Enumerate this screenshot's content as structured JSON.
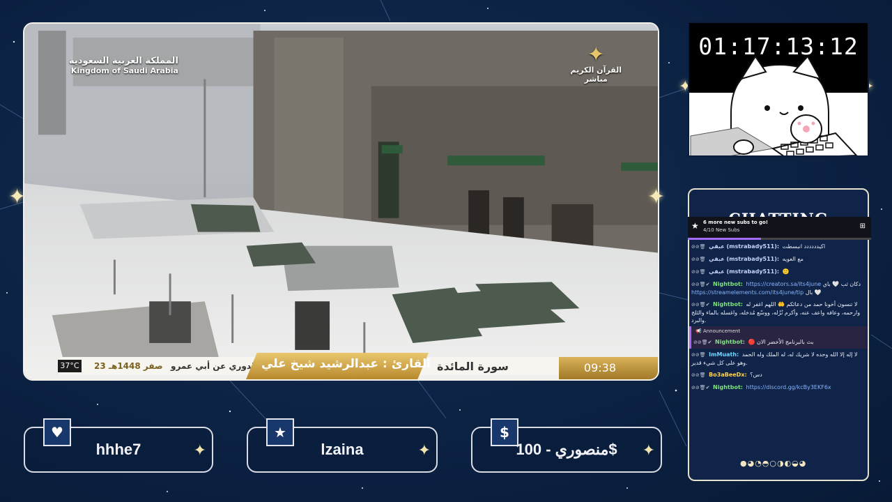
{
  "video": {
    "overlay_ksa_ar": "المملكة العربية السعودية",
    "overlay_ksa_en": "Kingdom of Saudi Arabia",
    "channel_name": "القرآن الكريم",
    "channel_status": "مباشر",
    "temperature": "37°C",
    "date_hijri": "23 صفر 1448هـ",
    "narration": "رواية الدوري عن أبي عمرو",
    "reader": "القارئ : عبدالرشيد شيخ علي",
    "surah": "سورة المائدة",
    "clock": "09:38"
  },
  "timer": "01:17:13:12",
  "chat": {
    "heading": "CHATTING",
    "sub_goal_title": "6 more new subs to go!",
    "sub_goal_count": "4/10 New Subs",
    "sub_goal_progress": 0.4,
    "announcement_label": "Announcement",
    "messages": [
      {
        "badges": "⊘⊘🗑",
        "user": "عبقي (mstrabady511):",
        "user_color": "#c8d4ff",
        "text": "اكيدددددد انبسطت"
      },
      {
        "badges": "⊘⊘🗑",
        "user": "عبقي (mstrabady511):",
        "user_color": "#c8d4ff",
        "text": "مع العويه"
      },
      {
        "badges": "⊘⊘🗑",
        "user": "عبقي (mstrabady511):",
        "user_color": "#c8d4ff",
        "text": "🙂"
      },
      {
        "badges": "⊘⊘🗑✔",
        "user": "Nightbot:",
        "user_color": "#7fe07f",
        "text": "دكان ثب 🤍 باي",
        "link": "https://creators.sa/its4june",
        "text2": "بال 🤍",
        "link2": "https://streamelements.com/its4june/tip"
      },
      {
        "badges": "⊘⊘🗑✔",
        "user": "Nightbot:",
        "user_color": "#7fe07f",
        "text": "لا تنسون أخونا حمد من دعائكم 🤲 اللهم اغفر له وارحمه، وعافه واعف عنه، وأكرم نُزُله، ووسّع مُدخله، واغسله بالماء والثلج والبرد."
      },
      {
        "badges": "⊘⊘🗑✔",
        "user": "Nightbot:",
        "user_color": "#7fe07f",
        "text": "🔴 بث بالبرنامج الأخضر الان",
        "announce": true
      },
      {
        "badges": "⊘⊘🗑",
        "user": "ImMuath:",
        "user_color": "#6fd6ff",
        "text": "لا إله إلا الله وحده لا شريك له، له الملك وله الحمد وهو على كل شيء قدير."
      },
      {
        "badges": "⊘⊘🗑",
        "user": "Bo3aBeeDx:",
        "user_color": "#ffd24a",
        "text": "دس؟"
      },
      {
        "badges": "⊘⊘🗑✔",
        "user": "Nightbot:",
        "user_color": "#7fe07f",
        "text": "",
        "link": "https://discord.gg/kcBy3EKF6x"
      }
    ]
  },
  "cards": [
    {
      "icon": "heart-icon",
      "glyph": "♥",
      "label": "hhhe7"
    },
    {
      "icon": "star-icon",
      "glyph": "★",
      "label": "lzaina"
    },
    {
      "icon": "dollar-icon",
      "glyph": "$",
      "label": "منصوري - 100$"
    }
  ],
  "colors": {
    "accent_gold": "#d9b25a",
    "background": "#0d2446",
    "frame": "#f3f1ea"
  }
}
